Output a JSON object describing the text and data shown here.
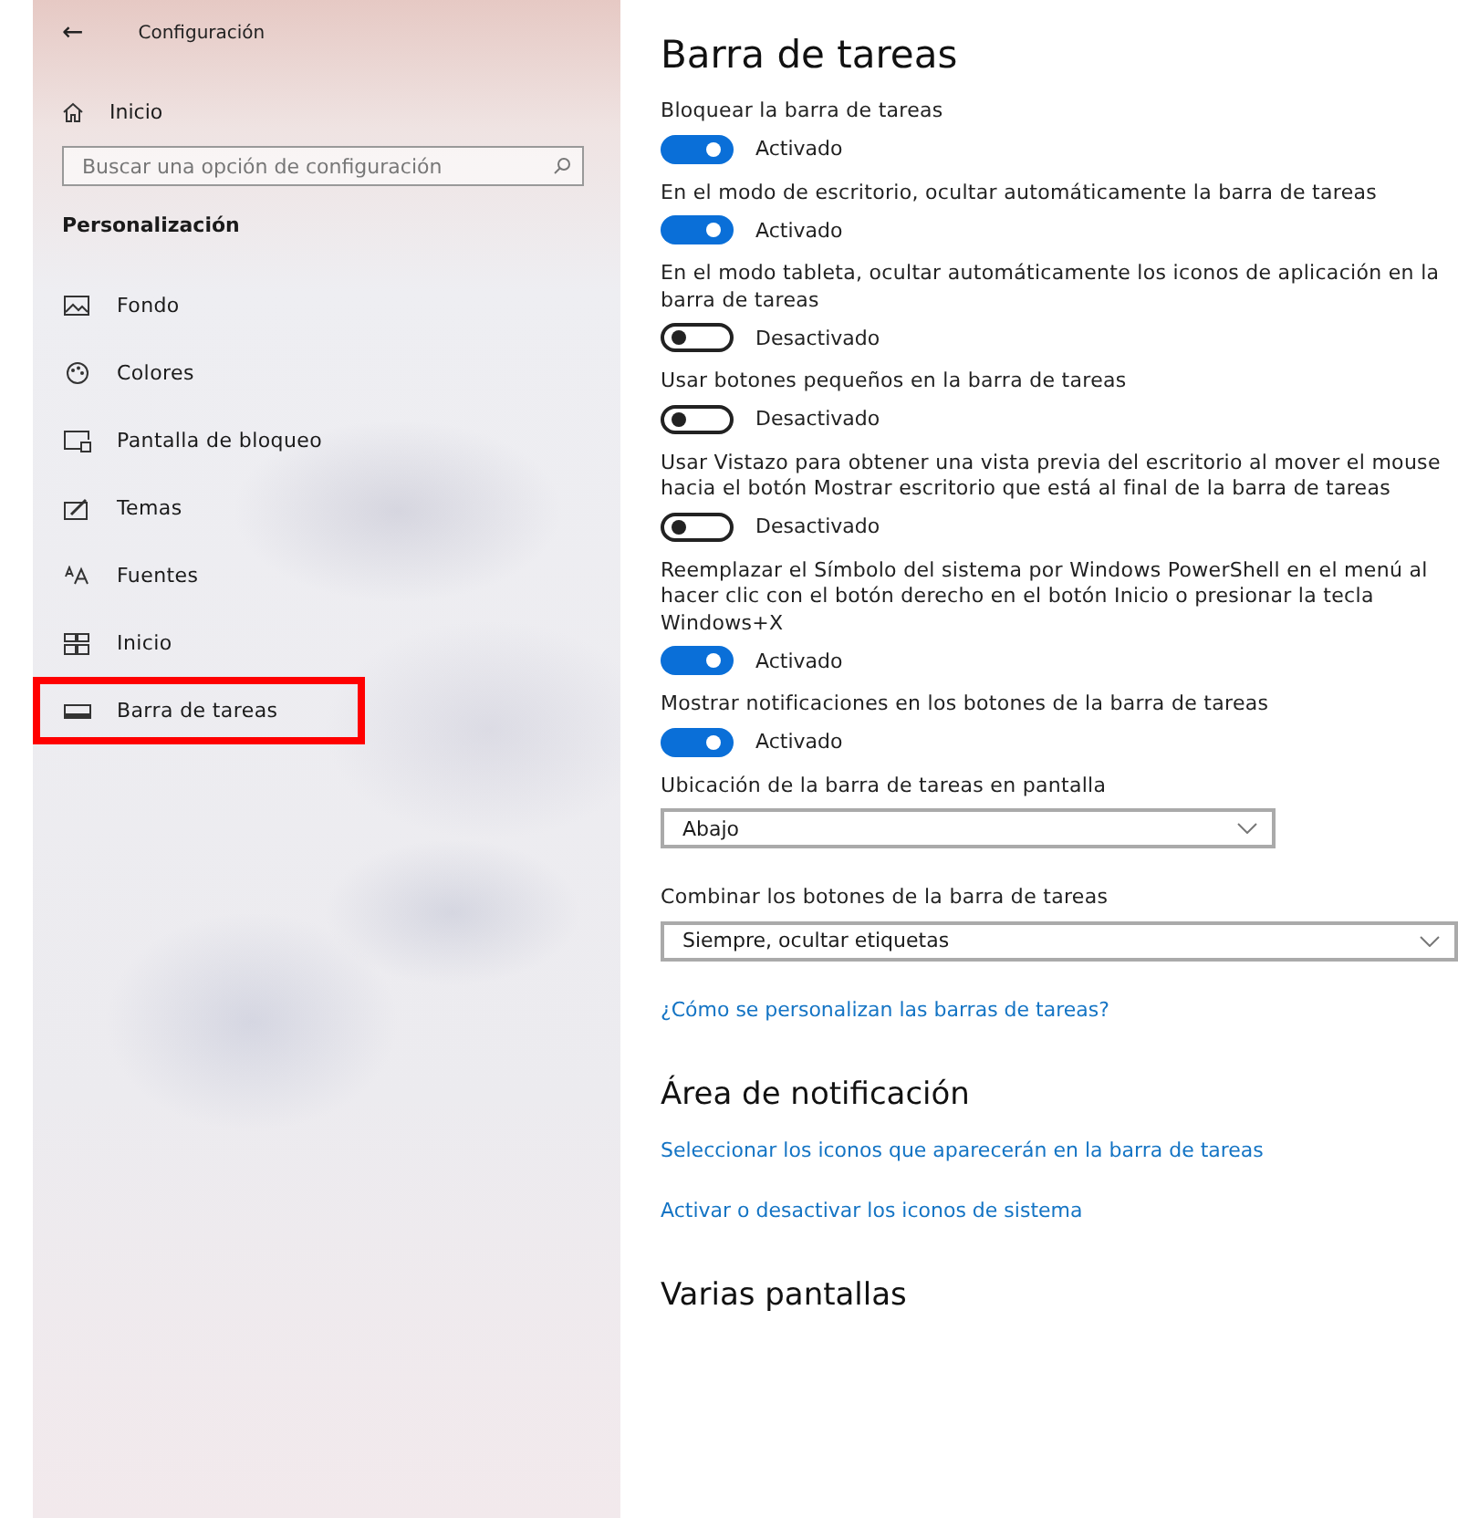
{
  "window": {
    "title": "Configuración",
    "back": "←"
  },
  "sidebar": {
    "home": "Inicio",
    "search": {
      "placeholder": "Buscar una opción de configuración"
    },
    "section": "Personalización",
    "items": [
      {
        "label": "Fondo",
        "selected": false
      },
      {
        "label": "Colores",
        "selected": false
      },
      {
        "label": "Pantalla de bloqueo",
        "selected": false
      },
      {
        "label": "Temas",
        "selected": false
      },
      {
        "label": "Fuentes",
        "selected": false
      },
      {
        "label": "Inicio",
        "selected": false
      },
      {
        "label": "Barra de tareas",
        "selected": true
      }
    ]
  },
  "main": {
    "title": "Barra de tareas",
    "settings": [
      {
        "kind": "toggle",
        "label": "Bloquear la barra de tareas",
        "on": true,
        "state": "Activado"
      },
      {
        "kind": "toggle",
        "label": "En el modo de escritorio, ocultar automáticamente la barra de tareas",
        "on": true,
        "state": "Activado"
      },
      {
        "kind": "toggle",
        "label": "En el modo tableta, ocultar automáticamente los iconos de aplicación en la barra de tareas",
        "on": false,
        "state": "Desactivado"
      },
      {
        "kind": "toggle",
        "label": "Usar botones pequeños en la barra de tareas",
        "on": false,
        "state": "Desactivado"
      },
      {
        "kind": "toggle",
        "label": "Usar Vistazo para obtener una vista previa del escritorio al mover el mouse hacia el botón Mostrar escritorio que está al final de la barra de tareas",
        "on": false,
        "state": "Desactivado"
      },
      {
        "kind": "toggle",
        "label": "Reemplazar el Símbolo del sistema por Windows PowerShell en el menú al hacer clic con el botón derecho en el botón Inicio o presionar la tecla Windows+X",
        "on": true,
        "state": "Activado"
      },
      {
        "kind": "toggle",
        "label": "Mostrar notificaciones en los botones de la barra de tareas",
        "on": true,
        "state": "Activado"
      },
      {
        "kind": "dropdown",
        "label": "Ubicación de la barra de tareas en pantalla",
        "value": "Abajo",
        "wide": false
      },
      {
        "kind": "dropdown",
        "label": "Combinar los botones de la barra de tareas",
        "value": "Siempre, ocultar etiquetas",
        "wide": true
      }
    ],
    "help_link": "¿Cómo se personalizan las barras de tareas?",
    "notification_area": {
      "title": "Área de notificación",
      "links": [
        "Seleccionar los iconos que aparecerán en la barra de tareas",
        "Activar o desactivar los iconos de sistema"
      ]
    },
    "multiple_displays": {
      "title": "Varias pantallas"
    }
  }
}
